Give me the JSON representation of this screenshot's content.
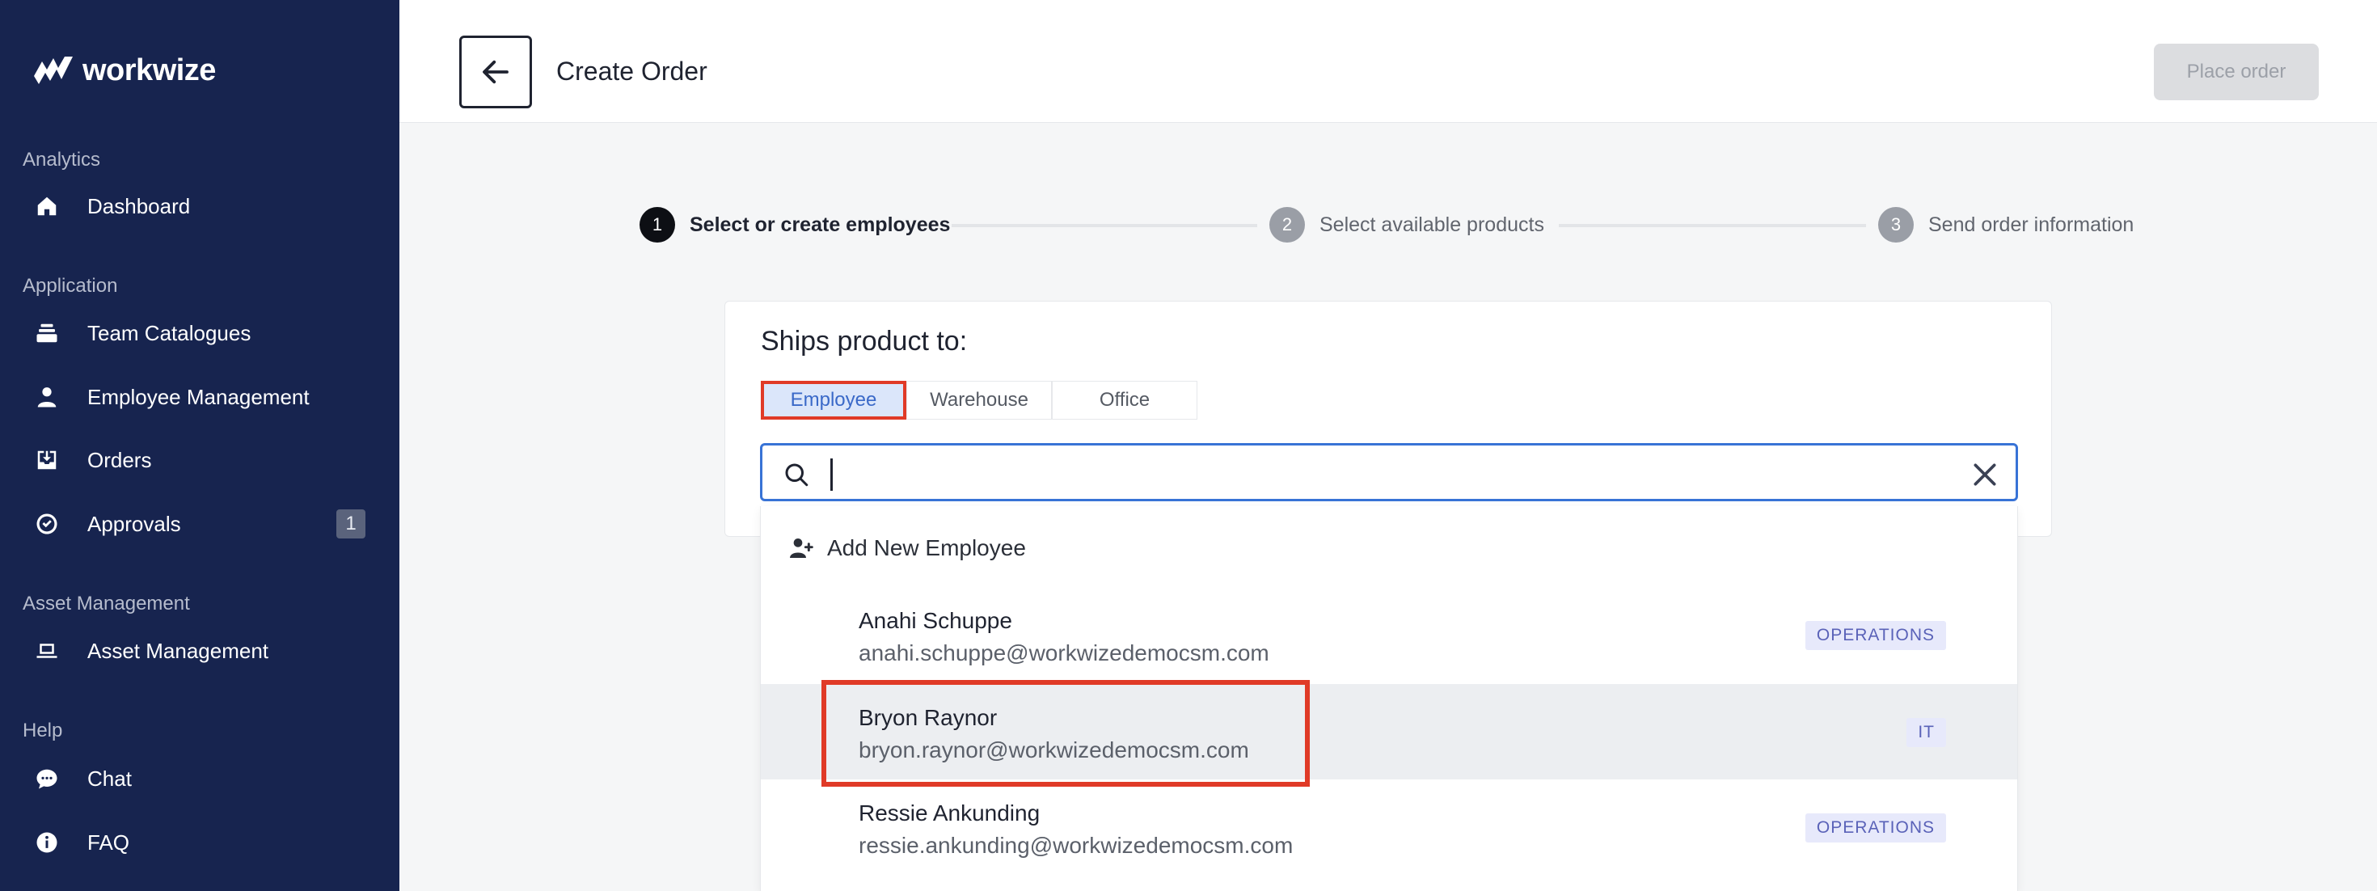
{
  "brand": {
    "name": "workwize"
  },
  "sidebar": {
    "sections": [
      {
        "label": "Analytics"
      },
      {
        "label": "Application"
      },
      {
        "label": "Asset Management"
      },
      {
        "label": "Help"
      }
    ],
    "items": [
      {
        "label": "Dashboard",
        "icon": "home-icon"
      },
      {
        "label": "Team Catalogues",
        "icon": "stack-icon"
      },
      {
        "label": "Employee Management",
        "icon": "person-icon"
      },
      {
        "label": "Orders",
        "icon": "tray-download-icon"
      },
      {
        "label": "Approvals",
        "icon": "check-circle-icon",
        "badge": "1"
      },
      {
        "label": "Asset Management",
        "icon": "laptop-icon"
      },
      {
        "label": "Chat",
        "icon": "chat-bubble-icon"
      },
      {
        "label": "FAQ",
        "icon": "info-icon"
      }
    ]
  },
  "header": {
    "title": "Create Order",
    "place_order_label": "Place order"
  },
  "stepper": {
    "steps": [
      {
        "num": "1",
        "label": "Select or create employees",
        "active": true
      },
      {
        "num": "2",
        "label": "Select available products",
        "active": false
      },
      {
        "num": "3",
        "label": "Send order information",
        "active": false
      }
    ]
  },
  "ships": {
    "title": "Ships product to:",
    "tabs": [
      {
        "label": "Employee",
        "selected": true
      },
      {
        "label": "Warehouse",
        "selected": false
      },
      {
        "label": "Office",
        "selected": false
      }
    ]
  },
  "search": {
    "value": "",
    "placeholder": ""
  },
  "dropdown": {
    "add_new_label": "Add New Employee",
    "employees": [
      {
        "name": "Anahi Schuppe",
        "email": "anahi.schuppe@workwizedemocsm.com",
        "department": "OPERATIONS"
      },
      {
        "name": "Bryon Raynor",
        "email": "bryon.raynor@workwizedemocsm.com",
        "department": "IT"
      },
      {
        "name": "Ressie Ankunding",
        "email": "ressie.ankunding@workwizedemocsm.com",
        "department": "OPERATIONS"
      }
    ]
  },
  "colors": {
    "sidebar_bg": "#17244f",
    "accent_blue": "#3873d6",
    "highlight_red": "#e03a27",
    "tag_bg": "#e7e9fb"
  }
}
